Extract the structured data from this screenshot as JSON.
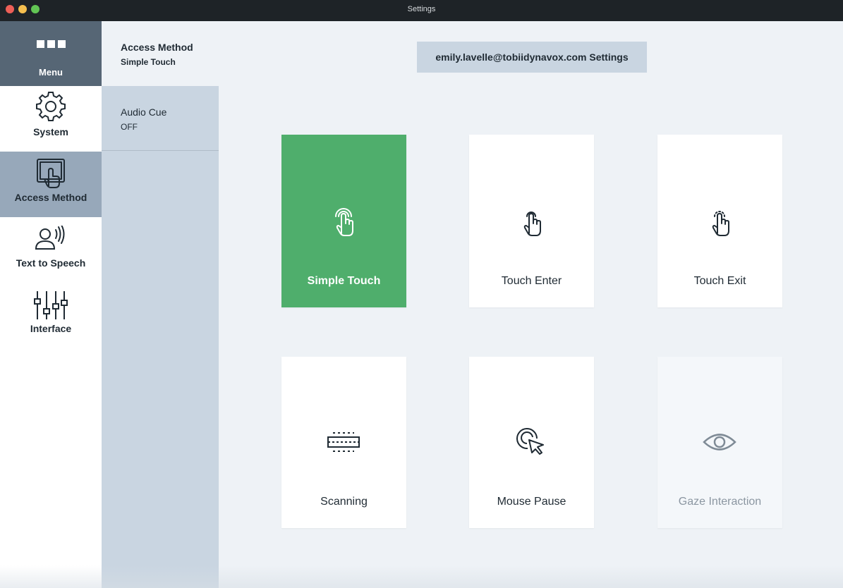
{
  "window": {
    "title": "Settings"
  },
  "sidebar": {
    "menu": {
      "label": "Menu",
      "icon": "menu-grid-icon"
    },
    "items": [
      {
        "label": "System",
        "icon": "gear-icon",
        "active": false
      },
      {
        "label": "Access Method",
        "icon": "touch-screen-icon",
        "active": true
      },
      {
        "label": "Text to Speech",
        "icon": "speaking-head-icon",
        "active": false
      },
      {
        "label": "Interface",
        "icon": "sliders-icon",
        "active": false
      }
    ]
  },
  "subpanel": {
    "title": "Access Method",
    "value": "Simple Touch",
    "items": [
      {
        "title": "Audio Cue",
        "value": "OFF"
      }
    ]
  },
  "account": {
    "label": "emily.lavelle@tobiidynavox.com Settings"
  },
  "access_methods": [
    {
      "label": "Simple Touch",
      "icon": "tap-finger-icon",
      "state": "selected"
    },
    {
      "label": "Touch Enter",
      "icon": "touch-enter-icon",
      "state": "normal"
    },
    {
      "label": "Touch Exit",
      "icon": "touch-exit-icon",
      "state": "normal"
    },
    {
      "label": "Scanning",
      "icon": "scanning-icon",
      "state": "normal"
    },
    {
      "label": "Mouse Pause",
      "icon": "mouse-pause-icon",
      "state": "normal"
    },
    {
      "label": "Gaze Interaction",
      "icon": "eye-icon",
      "state": "disabled"
    }
  ],
  "colors": {
    "selected_card": "#4fae6c",
    "sidebar_menu": "#566675",
    "sidebar_active": "#97a8ba",
    "subpanel": "#c9d5e1",
    "background": "#eef2f6"
  }
}
